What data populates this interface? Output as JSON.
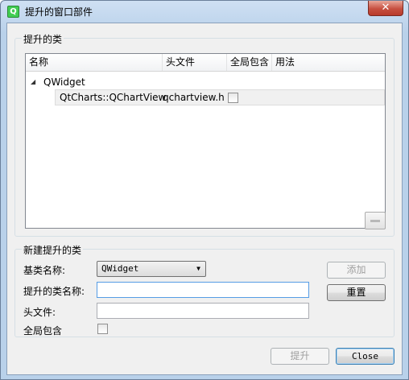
{
  "window": {
    "title": "提升的窗口部件",
    "close_glyph": "✕"
  },
  "promoted_group": {
    "title": "提升的类",
    "columns": [
      "名称",
      "头文件",
      "全局包含",
      "用法"
    ],
    "tree": {
      "parent": "QWidget",
      "child": {
        "name": "QtCharts::QChartView",
        "header": "qchartview.h",
        "global_include": false
      }
    },
    "remove_button_icon": "minus-icon"
  },
  "new_group": {
    "title": "新建提升的类",
    "base_class_label": "基类名称:",
    "base_class_value": "QWidget",
    "class_name_label": "提升的类名称:",
    "class_name_value": "",
    "header_label": "头文件:",
    "header_value": "",
    "global_include_label": "全局包含",
    "global_include": false,
    "add_button": "添加",
    "reset_button": "重置"
  },
  "footer": {
    "promote_button": "提升",
    "close_button": "Close"
  }
}
